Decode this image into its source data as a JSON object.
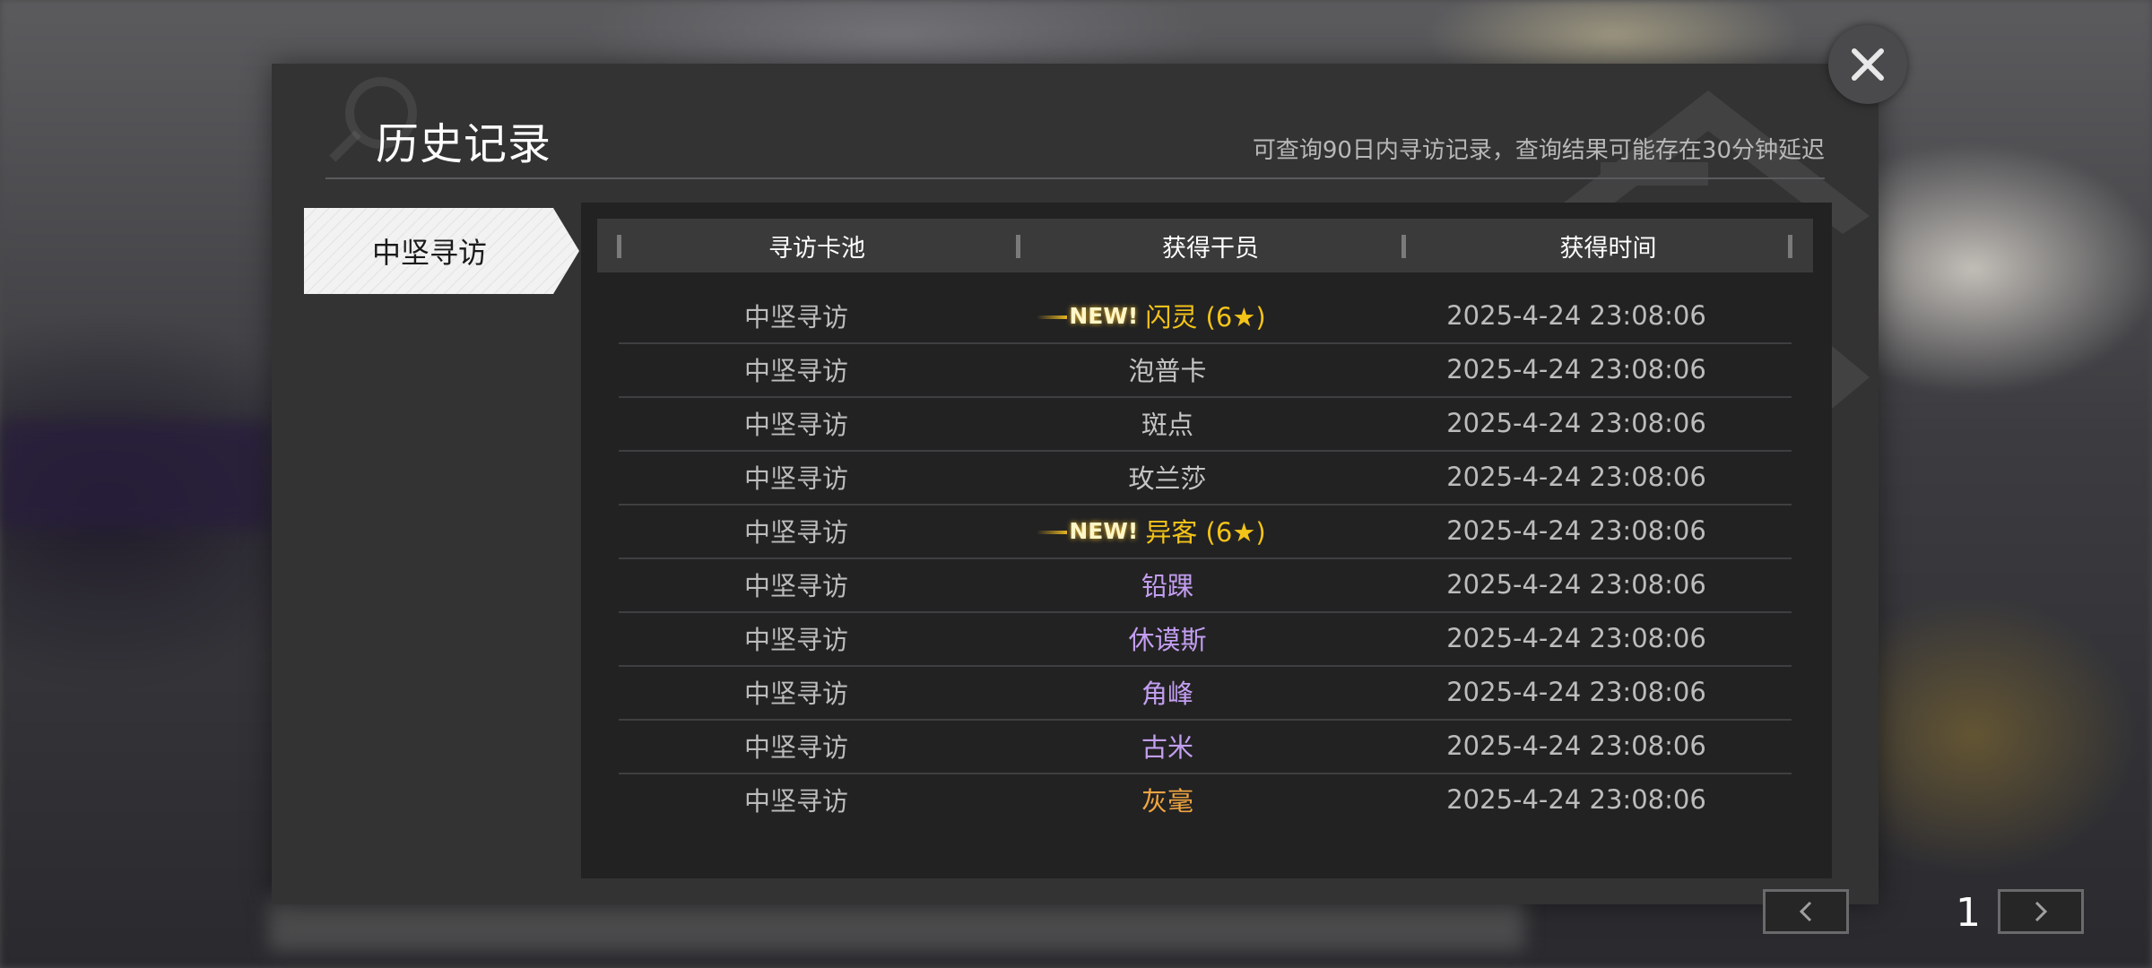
{
  "dialog": {
    "title": "历史记录",
    "notice": "可查询90日内寻访记录，查询结果可能存在30分钟延迟"
  },
  "tabs": [
    {
      "label": "中坚寻访",
      "selected": true
    }
  ],
  "table": {
    "headers": [
      "寻访卡池",
      "获得干员",
      "获得时间"
    ],
    "new_label": "NEW!",
    "rows": [
      {
        "pool": "中坚寻访",
        "operator": "闪灵 (6★)",
        "is_new": true,
        "rarity_color": "gold",
        "time": "2025-4-24 23:08:06"
      },
      {
        "pool": "中坚寻访",
        "operator": "泡普卡",
        "is_new": false,
        "rarity_color": "white",
        "time": "2025-4-24 23:08:06"
      },
      {
        "pool": "中坚寻访",
        "operator": "斑点",
        "is_new": false,
        "rarity_color": "white",
        "time": "2025-4-24 23:08:06"
      },
      {
        "pool": "中坚寻访",
        "operator": "玫兰莎",
        "is_new": false,
        "rarity_color": "white",
        "time": "2025-4-24 23:08:06"
      },
      {
        "pool": "中坚寻访",
        "operator": "异客 (6★)",
        "is_new": true,
        "rarity_color": "gold",
        "time": "2025-4-24 23:08:06"
      },
      {
        "pool": "中坚寻访",
        "operator": "铅踝",
        "is_new": false,
        "rarity_color": "purple",
        "time": "2025-4-24 23:08:06"
      },
      {
        "pool": "中坚寻访",
        "operator": "休谟斯",
        "is_new": false,
        "rarity_color": "purple",
        "time": "2025-4-24 23:08:06"
      },
      {
        "pool": "中坚寻访",
        "operator": "角峰",
        "is_new": false,
        "rarity_color": "purple",
        "time": "2025-4-24 23:08:06"
      },
      {
        "pool": "中坚寻访",
        "operator": "古米",
        "is_new": false,
        "rarity_color": "purple",
        "time": "2025-4-24 23:08:06"
      },
      {
        "pool": "中坚寻访",
        "operator": "灰毫",
        "is_new": false,
        "rarity_color": "orange",
        "time": "2025-4-24 23:08:06"
      }
    ]
  },
  "pagination": {
    "current_page": "1",
    "prev_icon": "chevron-left-icon",
    "next_icon": "chevron-right-icon"
  },
  "close_icon": "close-icon",
  "colors": {
    "gold": "#f3c318",
    "purple": "#c39ef0",
    "orange": "#f0a540",
    "white": "#c4c4c4"
  }
}
